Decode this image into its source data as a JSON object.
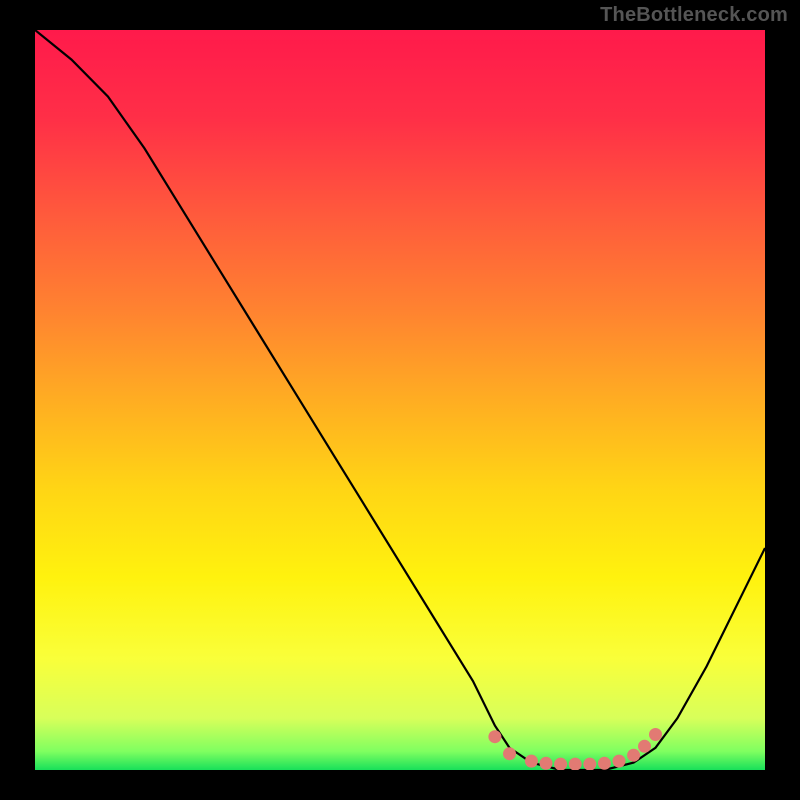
{
  "attribution": "TheBottleneck.com",
  "chart_data": {
    "type": "line",
    "title": "",
    "xlabel": "",
    "ylabel": "",
    "xlim": [
      0,
      100
    ],
    "ylim": [
      0,
      100
    ],
    "series": [
      {
        "name": "curve",
        "x": [
          0,
          5,
          10,
          15,
          20,
          25,
          30,
          35,
          40,
          45,
          50,
          55,
          60,
          63,
          65,
          68,
          72,
          78,
          82,
          85,
          88,
          92,
          96,
          100
        ],
        "y": [
          100,
          96,
          91,
          84,
          76,
          68,
          60,
          52,
          44,
          36,
          28,
          20,
          12,
          6,
          3,
          1,
          0,
          0,
          1,
          3,
          7,
          14,
          22,
          30
        ]
      }
    ],
    "highlight_points": {
      "name": "bottom-dots",
      "color": "#e27a73",
      "points": [
        {
          "x": 63,
          "y": 4.5
        },
        {
          "x": 65,
          "y": 2.2
        },
        {
          "x": 68,
          "y": 1.2
        },
        {
          "x": 70,
          "y": 0.9
        },
        {
          "x": 72,
          "y": 0.8
        },
        {
          "x": 74,
          "y": 0.8
        },
        {
          "x": 76,
          "y": 0.8
        },
        {
          "x": 78,
          "y": 0.9
        },
        {
          "x": 80,
          "y": 1.2
        },
        {
          "x": 82,
          "y": 2.0
        },
        {
          "x": 83.5,
          "y": 3.2
        },
        {
          "x": 85,
          "y": 4.8
        }
      ]
    },
    "gradient_stops": [
      {
        "offset": 0.0,
        "color": "#ff1a4b"
      },
      {
        "offset": 0.12,
        "color": "#ff2f47"
      },
      {
        "offset": 0.25,
        "color": "#ff5a3c"
      },
      {
        "offset": 0.38,
        "color": "#ff8330"
      },
      {
        "offset": 0.5,
        "color": "#ffad22"
      },
      {
        "offset": 0.62,
        "color": "#ffd515"
      },
      {
        "offset": 0.74,
        "color": "#fff20e"
      },
      {
        "offset": 0.85,
        "color": "#f9ff3a"
      },
      {
        "offset": 0.93,
        "color": "#d8ff5a"
      },
      {
        "offset": 0.975,
        "color": "#7fff60"
      },
      {
        "offset": 1.0,
        "color": "#18e05a"
      }
    ]
  }
}
